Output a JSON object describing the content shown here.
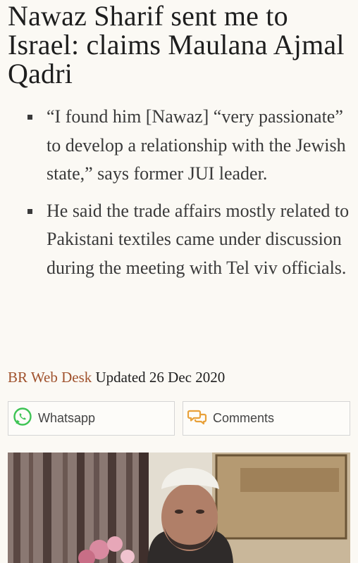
{
  "article": {
    "headline": "Nawaz Sharif sent me to Israel: claims Maulana Ajmal Qadri",
    "highlights": [
      "“I found him [Nawaz] “very passionate” to develop a relationship with the Jewish state,” says former JUI leader.",
      "He said the trade affairs mostly related to Pakistani textiles came under discussion during the meeting with Tel viv officials."
    ],
    "byline": {
      "author": "BR Web Desk",
      "updated": "Updated 26 Dec 2020"
    }
  },
  "share": {
    "whatsapp_label": "Whatsapp",
    "comments_label": "Comments"
  },
  "icons": {
    "whatsapp": "whatsapp-icon",
    "comments": "comments-icon"
  },
  "colors": {
    "author": "#a0522d",
    "whatsapp": "#3ec455",
    "comments": "#e8a13a",
    "background": "#fbf9f4"
  }
}
